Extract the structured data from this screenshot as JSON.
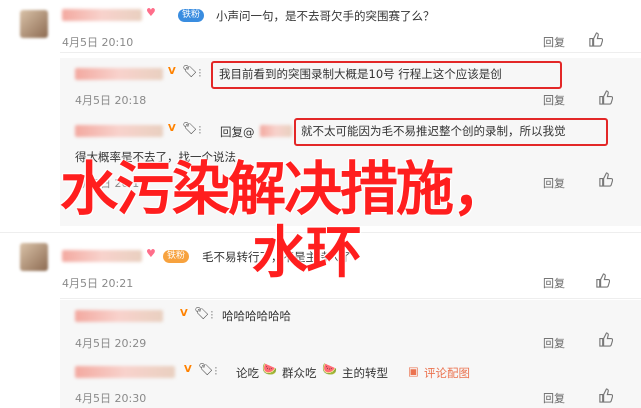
{
  "colors": {
    "accent": "#ff8200",
    "highlight_box": "#e32727",
    "overlay_text": "#ff1e1e",
    "meta": "#8a8a8a"
  },
  "comments": [
    {
      "text": "小声问一句，是不去哥欠手的突围赛了么？",
      "badge": "铁粉",
      "time": "4月5日 20:10",
      "reply": "回复",
      "icon": "thumbs-up-icon"
    },
    {
      "text": "我目前看到的突围录制大概是10号 行程上这个应该是创",
      "time": "4月5日 20:18",
      "reply": "回复",
      "icon": "thumbs-up-icon"
    },
    {
      "prefix": "回复@",
      "text": "就不太可能因为毛不易推迟整个创的录制，所以我觉",
      "time": "4月5日 20:19",
      "reply": "回复",
      "icon": "thumbs-up-icon",
      "partial_text": "得大概率是不去了，找一个说法"
    },
    {
      "text": "毛不易转行了，不是主持人了",
      "badge": "铁粉",
      "time": "4月5日 20:21",
      "reply": "回复",
      "icon": "thumbs-up-icon"
    },
    {
      "text": "哈哈哈哈哈哈",
      "time": "4月5日 20:29",
      "reply": "回复",
      "icon": "thumbs-up-icon"
    },
    {
      "text_a": "论吃",
      "text_b": "群众吃",
      "text_c": "主的转型",
      "link": "评论配图",
      "time": "4月5日 20:30",
      "reply": "回复",
      "icon": "thumbs-up-icon"
    }
  ],
  "overlay": {
    "line1": "水污染解决措施，",
    "line2": "水环"
  }
}
